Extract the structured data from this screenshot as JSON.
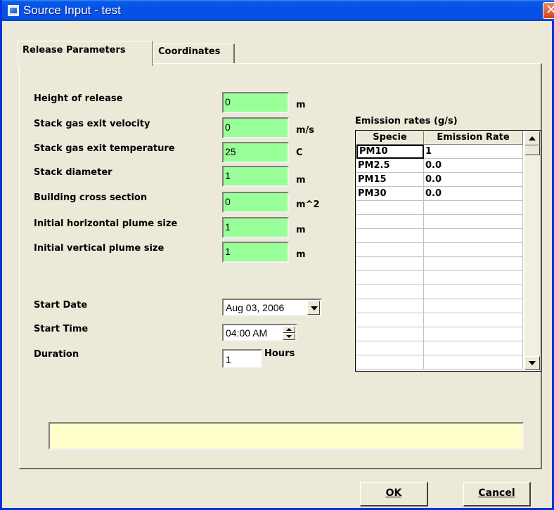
{
  "window": {
    "title": "Source Input - test"
  },
  "tabs": [
    {
      "label": "Release Parameters",
      "active": true
    },
    {
      "label": "Coordinates",
      "active": false
    }
  ],
  "params": [
    {
      "label": "Height of release",
      "value": "0",
      "unit": "m"
    },
    {
      "label": "Stack gas exit velocity",
      "value": "0",
      "unit": "m/s"
    },
    {
      "label": "Stack gas exit temperature",
      "value": "25",
      "unit": "C"
    },
    {
      "label": "Stack diameter",
      "value": "1",
      "unit": "m"
    },
    {
      "label": "Building cross section",
      "value": "0",
      "unit": "m^2"
    },
    {
      "label": "Initial horizontal plume size",
      "value": "1",
      "unit": "m"
    },
    {
      "label": "Initial vertical plume size",
      "value": "1",
      "unit": "m"
    }
  ],
  "timing": {
    "start_date_label": "Start Date",
    "start_date_value": "Aug 03, 2006",
    "start_time_label": "Start Time",
    "start_time_value": "04:00 AM",
    "duration_label": "Duration",
    "duration_value": "1",
    "duration_unit": "Hours"
  },
  "emissions": {
    "title": "Emission rates (g/s)",
    "headers": [
      "Specie",
      "Emission Rate"
    ],
    "rows": [
      [
        "PM10",
        "1"
      ],
      [
        "PM2.5",
        "0.0"
      ],
      [
        "PM15",
        "0.0"
      ],
      [
        "PM30",
        "0.0"
      ]
    ]
  },
  "message": "",
  "buttons": {
    "ok": "OK",
    "cancel": "Cancel"
  },
  "colors": {
    "field_bg": "#99ff99",
    "message_bg": "#ffffcc",
    "titlebar": "#0551e8"
  }
}
